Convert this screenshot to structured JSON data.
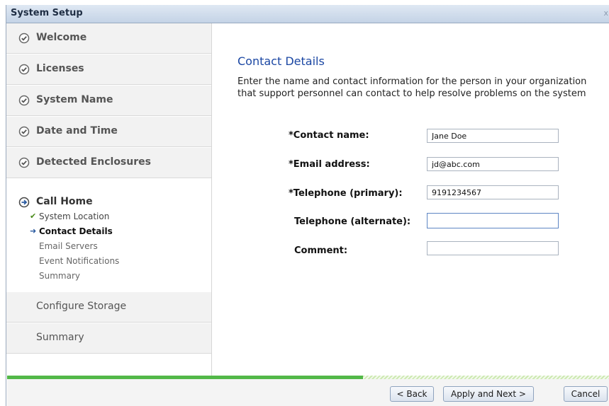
{
  "window": {
    "title": "System Setup",
    "close_label": "x"
  },
  "sidebar": {
    "steps": [
      {
        "label": "Welcome"
      },
      {
        "label": "Licenses"
      },
      {
        "label": "System Name"
      },
      {
        "label": "Date and Time"
      },
      {
        "label": "Detected Enclosures"
      }
    ],
    "call_home": {
      "label": "Call Home",
      "substeps": [
        {
          "label": "System Location",
          "state": "done"
        },
        {
          "label": "Contact Details",
          "state": "current"
        },
        {
          "label": "Email Servers",
          "state": "pending"
        },
        {
          "label": "Event Notifications",
          "state": "pending"
        },
        {
          "label": "Summary",
          "state": "pending"
        }
      ]
    },
    "later_steps": [
      {
        "label": "Configure Storage"
      },
      {
        "label": "Summary"
      }
    ]
  },
  "main": {
    "heading": "Contact Details",
    "intro_line1": "Enter the name and contact information for the person in your organization",
    "intro_line2": "that support personnel can contact to help resolve problems on the system",
    "fields": {
      "contact_name": {
        "label": "*Contact name:",
        "value": "Jane Doe"
      },
      "email": {
        "label": "*Email address:",
        "value": "jd@abc.com"
      },
      "tel_primary": {
        "label": "*Telephone (primary):",
        "value": "9191234567"
      },
      "tel_alternate": {
        "label": "Telephone (alternate):",
        "value": ""
      },
      "comment": {
        "label": "Comment:",
        "value": ""
      }
    }
  },
  "progress": {
    "fraction": 0.59
  },
  "footer": {
    "back_label": "< Back",
    "next_label": "Apply and Next >",
    "cancel_label": "Cancel"
  },
  "colors": {
    "accent": "#1b47a3",
    "progress": "#52b848",
    "check": "#4a8a1a"
  }
}
